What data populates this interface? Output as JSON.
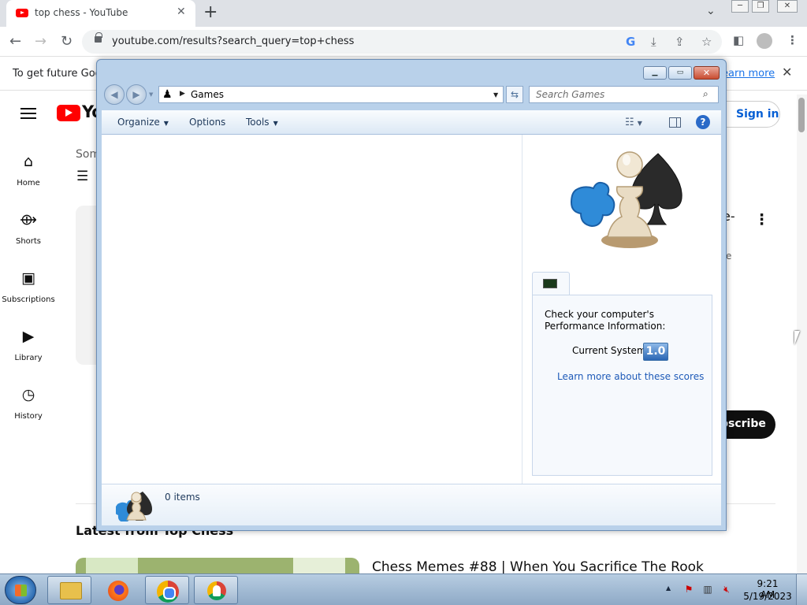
{
  "browser": {
    "tab_title": "top chess - YouTube",
    "url": "youtube.com/results?search_query=top+chess",
    "infobar_text": "To get future Goog",
    "infobar_link": "earn more"
  },
  "youtube": {
    "logo_text": "Yo",
    "sidebar": [
      {
        "label": "Home",
        "icon": "home-icon"
      },
      {
        "label": "Shorts",
        "icon": "shorts-icon"
      },
      {
        "label": "Subscriptions",
        "icon": "subscriptions-icon"
      },
      {
        "label": "Library",
        "icon": "library-icon"
      },
      {
        "label": "History",
        "icon": "history-icon"
      }
    ],
    "signin": "Sign in",
    "some_label": "Som",
    "card_text_fragment": "e-",
    "sub_fragment": "e",
    "subscribe": "bscribe",
    "latest_heading": "Latest from Top Chess",
    "video_title": "Chess Memes #88 | When You Sacrifice The Rook"
  },
  "explorer": {
    "location": "Games",
    "search_placeholder": "Search Games",
    "commands": {
      "organize": "Organize",
      "options": "Options",
      "tools": "Tools"
    },
    "wei": {
      "text": "Check your computer's Performance Information:",
      "current_label": "Current System",
      "score": "1.0",
      "link": "Learn more about these scores"
    },
    "details": {
      "count": "0 items"
    }
  },
  "taskbar": {
    "time": "9:21 AM",
    "date": "5/19/2023"
  }
}
